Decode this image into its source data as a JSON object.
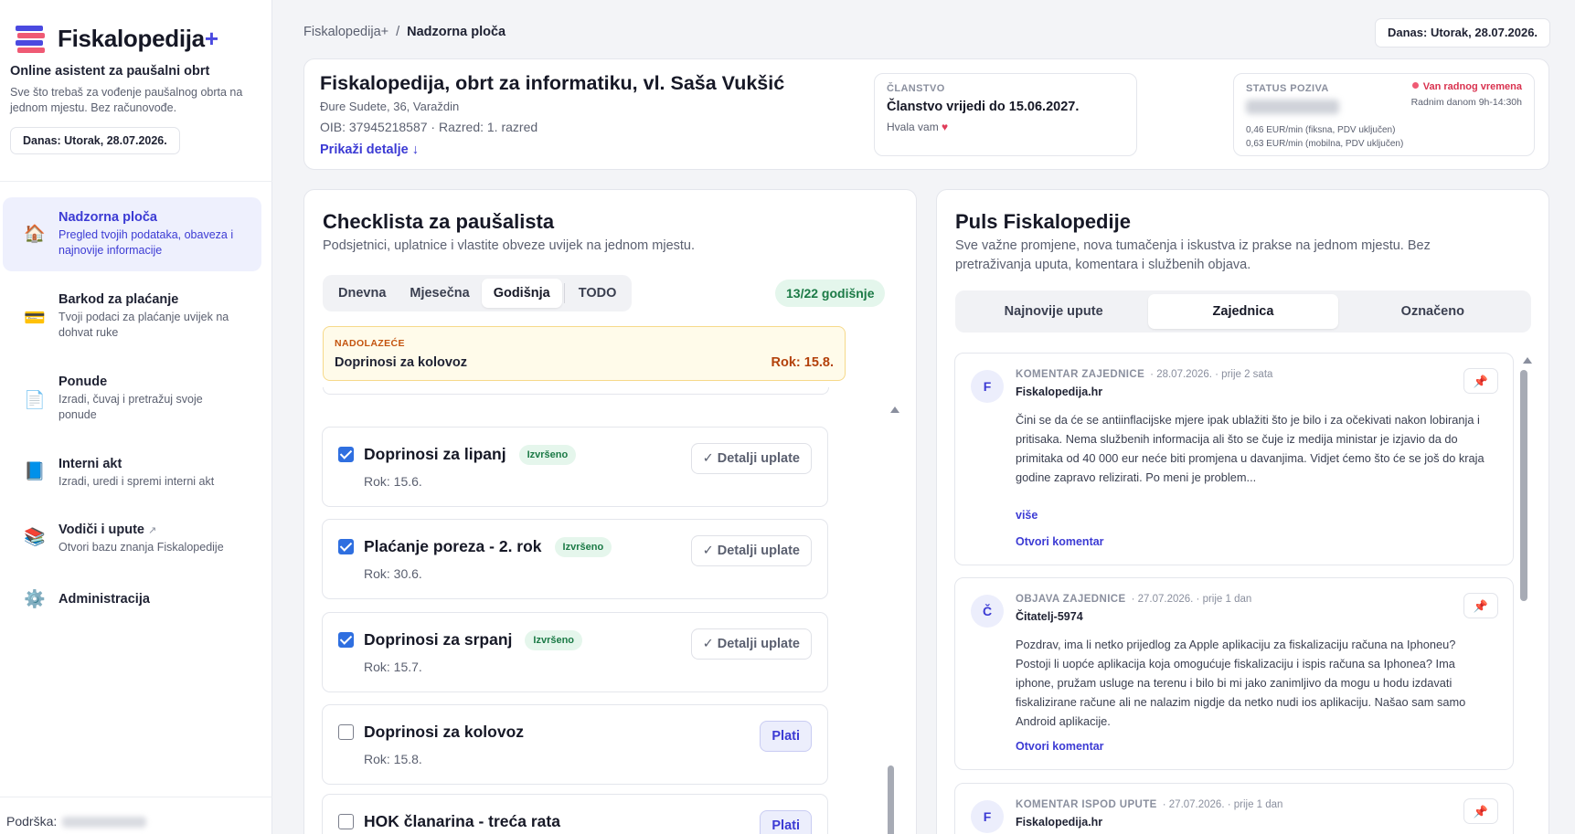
{
  "sidebar": {
    "brand_name": "Fiskalopedija",
    "brand_plus": "+",
    "tagline": "Online asistent za paušalni obrt",
    "tag_description": "Sve što trebaš za vođenje paušalnog obrta na jednom mjestu. Bez računovođe.",
    "date_label": "Danas: Utorak, 28.07.2026.",
    "items": [
      {
        "icon": "house-icon",
        "glyph": "🏠",
        "title": "Nadzorna ploča",
        "sub": "Pregled tvojih podataka, obaveza i najnovije informacije",
        "active": true
      },
      {
        "icon": "credit-card-icon",
        "glyph": "💳",
        "title": "Barkod za plaćanje",
        "sub": "Tvoji podaci za plaćanje uvijek na dohvat ruke"
      },
      {
        "icon": "document-icon",
        "glyph": "📄",
        "title": "Ponude",
        "sub": "Izradi, čuvaj i pretražuj svoje ponude"
      },
      {
        "icon": "book-icon",
        "glyph": "📘",
        "title": "Interni akt",
        "sub": "Izradi, uredi i spremi interni akt"
      },
      {
        "icon": "books-icon",
        "glyph": "📚",
        "title": "Vodiči i upute",
        "title_suffix": "↗",
        "sub": "Otvori bazu znanja Fiskalopedije"
      },
      {
        "icon": "gear-icon",
        "glyph": "⚙️",
        "title": "Administracija"
      }
    ],
    "support_label": "Podrška:"
  },
  "header": {
    "breadcrumb_root": "Fiskalopedija+",
    "breadcrumb_sep": "/",
    "breadcrumb_current": "Nadzorna ploča",
    "date_label": "Danas: Utorak, 28.07.2026."
  },
  "company": {
    "name": "Fiskalopedija, obrt za informatiku, vl. Saša Vukšić",
    "address": "Đure Sudete, 36, Varaždin",
    "oib_line": "OIB: 37945218587 · Razred: 1. razred",
    "details_link": "Prikaži detalje ↓"
  },
  "membership": {
    "label": "ČLANSTVO",
    "value": "Članstvo vrijedi do 15.06.2027.",
    "thanks": "Hvala vam",
    "heart": "♥"
  },
  "call_status": {
    "label": "STATUS POZIVA",
    "state": "Van radnog vremena",
    "hours": "Radnim danom 9h-14:30h",
    "rate_fixed": "0,46 EUR/min (fiksna, PDV uključen)",
    "rate_mobile": "0,63 EUR/min (mobilna, PDV uključen)"
  },
  "checklist": {
    "title": "Checklista za paušalista",
    "subtitle": "Podsjetnici, uplatnice i vlastite obveze uvijek na jednom mjestu.",
    "tabs": [
      "Dnevna",
      "Mjesečna",
      "Godišnja",
      "TODO"
    ],
    "active_tab": "Godišnja",
    "count_badge": "13/22 godišnje",
    "upcoming": {
      "label": "NADOLAZEĆE",
      "item": "Doprinosi za kolovoz",
      "due": "Rok: 15.8."
    },
    "done_badge": "Izvršeno",
    "details_button": "✓ Detalji uplate",
    "pay_button": "Plati",
    "items": [
      {
        "title": "Doprinosi za lipanj",
        "due": "Rok: 15.6.",
        "done": true
      },
      {
        "title": "Plaćanje poreza - 2. rok",
        "due": "Rok: 30.6.",
        "done": true
      },
      {
        "title": "Doprinosi za srpanj",
        "due": "Rok: 15.7.",
        "done": true
      },
      {
        "title": "Doprinosi za kolovoz",
        "due": "Rok: 15.8.",
        "done": false
      },
      {
        "title": "HOK članarina - treća rata",
        "due": "",
        "done": false
      }
    ]
  },
  "pulse": {
    "title": "Puls Fiskalopedije",
    "subtitle": "Sve važne promjene, nova tumačenja i iskustva iz prakse na jednom mjestu. Bez pretraživanja uputa, komentara i službenih objava.",
    "tabs": [
      "Najnovije upute",
      "Zajednica",
      "Označeno"
    ],
    "active_tab": "Zajednica",
    "more_label": "više",
    "open_label": "Otvori komentar",
    "posts": [
      {
        "avatar": "F",
        "kind": "KOMENTAR ZAJEDNICE",
        "meta": "· 28.07.2026. · prije 2 sata",
        "author": "Fiskalopedija.hr",
        "body": "Čini se da će se antiinflacijske mjere ipak ublažiti što je bilo i za očekivati nakon lobiranja i pritisaka. Nema službenih informacija ali što se čuje iz medija ministar je izjavio da do primitaka od 40 000 eur neće biti promjena u davanjima. Vidjet ćemo što će se još do kraja godine zapravo relizirati. Po meni je problem...",
        "has_more": true
      },
      {
        "avatar": "Č",
        "kind": "OBJAVA ZAJEDNICE",
        "meta": "· 27.07.2026. · prije 1 dan",
        "author": "Čitatelj-5974",
        "body": "Pozdrav, ima li netko prijedlog za Apple aplikaciju za fiskalizaciju računa na Iphoneu? Postoji li uopće aplikacija koja omogućuje fiskalizaciju i ispis računa sa Iphonea? Ima iphone, pružam usluge na terenu i bilo bi mi jako zanimljivo da mogu u hodu izdavati fiskalizirane račune ali ne nalazim nigdje da netko nudi ios aplikaciju. Našao sam samo Android aplikacije.",
        "has_more": false
      },
      {
        "avatar": "F",
        "kind": "KOMENTAR ISPOD UPUTE",
        "meta": "· 27.07.2026. · prije 1 dan",
        "author": "Fiskalopedija.hr",
        "body": "",
        "has_more": false
      }
    ]
  },
  "colors": {
    "accent": "#3c3bd4",
    "success": "#1b7a46",
    "warning": "#b3410b",
    "danger": "#d9324f"
  }
}
